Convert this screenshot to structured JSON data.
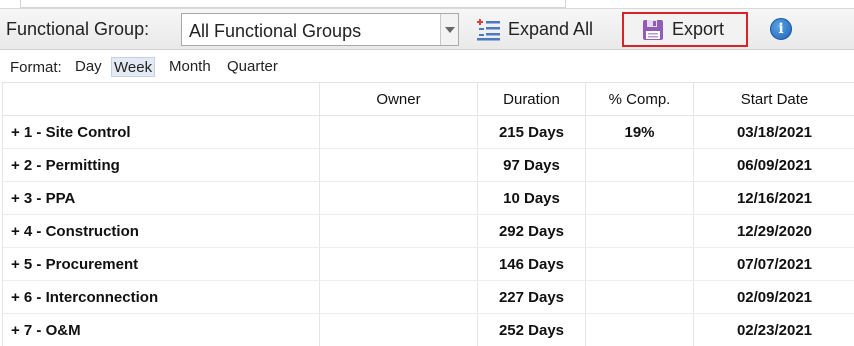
{
  "toolbar": {
    "functional_group_label": "Functional Group:",
    "functional_group_value": "All Functional Groups",
    "expand_all_label": "Expand All",
    "export_label": "Export",
    "info_icon": "info-icon",
    "info_glyph": "i",
    "export_highlight_color": "#d8232a"
  },
  "format": {
    "label": "Format:",
    "options": [
      "Day",
      "Week",
      "Month",
      "Quarter"
    ],
    "selected": "Week"
  },
  "grid": {
    "columns": [
      "",
      "Owner",
      "Duration",
      "% Comp.",
      "Start Date"
    ],
    "rows": [
      {
        "name": "+ 1 - Site Control",
        "owner": "",
        "duration": "215 Days",
        "pct": "19%",
        "start": "03/18/2021"
      },
      {
        "name": "+ 2 - Permitting",
        "owner": "",
        "duration": "97 Days",
        "pct": "",
        "start": "06/09/2021"
      },
      {
        "name": "+ 3 - PPA",
        "owner": "",
        "duration": "10 Days",
        "pct": "",
        "start": "12/16/2021"
      },
      {
        "name": "+ 4 - Construction",
        "owner": "",
        "duration": "292 Days",
        "pct": "",
        "start": "12/29/2020"
      },
      {
        "name": "+ 5 - Procurement",
        "owner": "",
        "duration": "146 Days",
        "pct": "",
        "start": "07/07/2021"
      },
      {
        "name": "+ 6 - Interconnection",
        "owner": "",
        "duration": "227 Days",
        "pct": "",
        "start": "02/09/2021"
      },
      {
        "name": "+ 7 - O&M",
        "owner": "",
        "duration": "252 Days",
        "pct": "",
        "start": "02/23/2021"
      }
    ]
  }
}
